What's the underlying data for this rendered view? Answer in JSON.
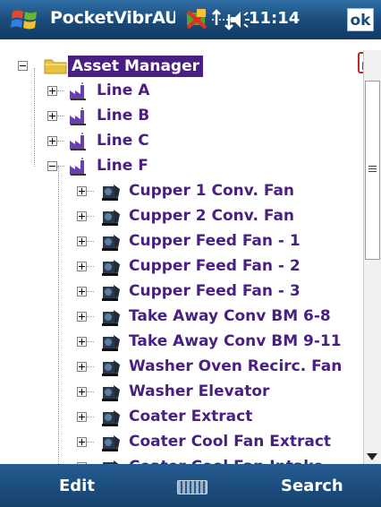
{
  "titlebar": {
    "app_title": "PocketVibrAUltr",
    "clock": "11:14",
    "ok_label": "ok",
    "icons": [
      "windows-start-icon",
      "sync-icon",
      "connectivity-icon",
      "volume-icon"
    ]
  },
  "tree": {
    "root": {
      "label": "Asset Manager",
      "icon": "folder-icon"
    },
    "lines": [
      {
        "label": "Line A",
        "icon": "factory-icon",
        "expanded": false
      },
      {
        "label": "Line B",
        "icon": "factory-icon",
        "expanded": false
      },
      {
        "label": "Line C",
        "icon": "factory-icon",
        "expanded": false
      },
      {
        "label": "Line F",
        "icon": "factory-icon",
        "expanded": true
      }
    ],
    "machines": [
      {
        "label": "Cupper 1 Conv. Fan",
        "icon": "machine-icon"
      },
      {
        "label": "Cupper 2 Conv. Fan",
        "icon": "machine-icon"
      },
      {
        "label": "Cupper Feed Fan - 1",
        "icon": "machine-icon"
      },
      {
        "label": "Cupper Feed Fan - 2",
        "icon": "machine-icon"
      },
      {
        "label": "Cupper Feed Fan - 3",
        "icon": "machine-icon"
      },
      {
        "label": "Take Away Conv BM 6-8",
        "icon": "machine-icon"
      },
      {
        "label": "Take Away Conv BM 9-11",
        "icon": "machine-icon"
      },
      {
        "label": "Washer Oven Recirc. Fan",
        "icon": "machine-icon"
      },
      {
        "label": "Washer Elevator",
        "icon": "machine-icon"
      },
      {
        "label": "Coater Extract",
        "icon": "machine-icon"
      },
      {
        "label": "Coater Cool Fan Extract",
        "icon": "machine-icon"
      },
      {
        "label": "Coater Cool Fan Intake",
        "icon": "machine-icon"
      }
    ]
  },
  "menubar": {
    "left_label": "Edit",
    "right_label": "Search",
    "center_icon": "keyboard-icon"
  },
  "colors": {
    "title_bar": "#1a4a78",
    "tree_text": "#4a1f84",
    "selection": "#4a1f84"
  }
}
